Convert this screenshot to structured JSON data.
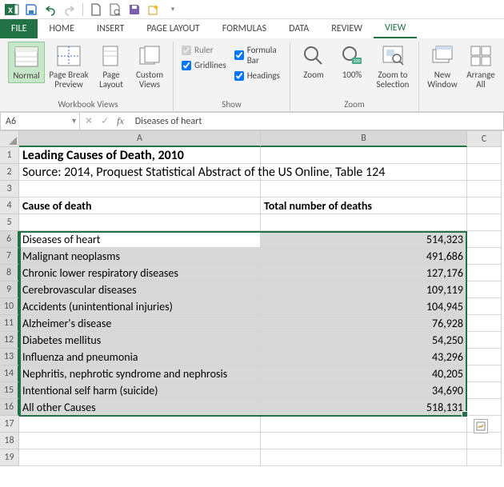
{
  "qat": {
    "excel_title": "X"
  },
  "tabs": {
    "file": "FILE",
    "items": [
      "HOME",
      "INSERT",
      "PAGE LAYOUT",
      "FORMULAS",
      "DATA",
      "REVIEW",
      "VIEW"
    ],
    "active_index": 6
  },
  "ribbon": {
    "workbook_views": {
      "label": "Workbook Views",
      "normal": "Normal",
      "page_break": "Page Break\nPreview",
      "page_layout": "Page\nLayout",
      "custom_views": "Custom\nViews"
    },
    "show": {
      "label": "Show",
      "ruler": "Ruler",
      "gridlines": "Gridlines",
      "formula_bar": "Formula Bar",
      "headings": "Headings"
    },
    "zoom": {
      "label": "Zoom",
      "zoom": "Zoom",
      "hundred": "100%",
      "to_selection": "Zoom to\nSelection"
    },
    "window": {
      "new_window": "New\nWindow",
      "arrange_all": "Arrange\nAll"
    }
  },
  "formula_bar": {
    "name_box": "A6",
    "input": "Diseases of heart"
  },
  "sheet": {
    "columns": [
      "A",
      "B",
      "C"
    ],
    "title": "Leading Causes of Death, 2010",
    "source": "Source: 2014, Proquest Statistical Abstract of the US Online, Table 124",
    "header_a": "Cause of death",
    "header_b": "Total number of deaths",
    "rows": [
      {
        "a": "Diseases of heart",
        "b": "514,323"
      },
      {
        "a": "Malignant neoplasms",
        "b": "491,686"
      },
      {
        "a": "Chronic lower respiratory diseases",
        "b": "127,176"
      },
      {
        "a": "Cerebrovascular diseases",
        "b": "109,119"
      },
      {
        "a": "Accidents (unintentional injuries)",
        "b": "104,945"
      },
      {
        "a": "Alzheimer's disease",
        "b": "76,928"
      },
      {
        "a": "Diabetes mellitus",
        "b": "54,250"
      },
      {
        "a": "Influenza and pneumonia",
        "b": "43,296"
      },
      {
        "a": "Nephritis, nephrotic syndrome and nephrosis",
        "b": "40,205"
      },
      {
        "a": "Intentional self harm (suicide)",
        "b": "34,690"
      },
      {
        "a": "All other Causes",
        "b": "518,131"
      }
    ],
    "row_nums": [
      "1",
      "2",
      "3",
      "4",
      "5",
      "6",
      "7",
      "8",
      "9",
      "10",
      "11",
      "12",
      "13",
      "14",
      "15",
      "16",
      "17",
      "18",
      "19"
    ]
  },
  "chart_data": {
    "type": "table",
    "title": "Leading Causes of Death, 2010",
    "columns": [
      "Cause of death",
      "Total number of deaths"
    ],
    "rows": [
      [
        "Diseases of heart",
        514323
      ],
      [
        "Malignant neoplasms",
        491686
      ],
      [
        "Chronic lower respiratory diseases",
        127176
      ],
      [
        "Cerebrovascular diseases",
        109119
      ],
      [
        "Accidents (unintentional injuries)",
        104945
      ],
      [
        "Alzheimer's disease",
        76928
      ],
      [
        "Diabetes mellitus",
        54250
      ],
      [
        "Influenza and pneumonia",
        43296
      ],
      [
        "Nephritis, nephrotic syndrome and nephrosis",
        40205
      ],
      [
        "Intentional self harm (suicide)",
        34690
      ],
      [
        "All other Causes",
        518131
      ]
    ]
  }
}
